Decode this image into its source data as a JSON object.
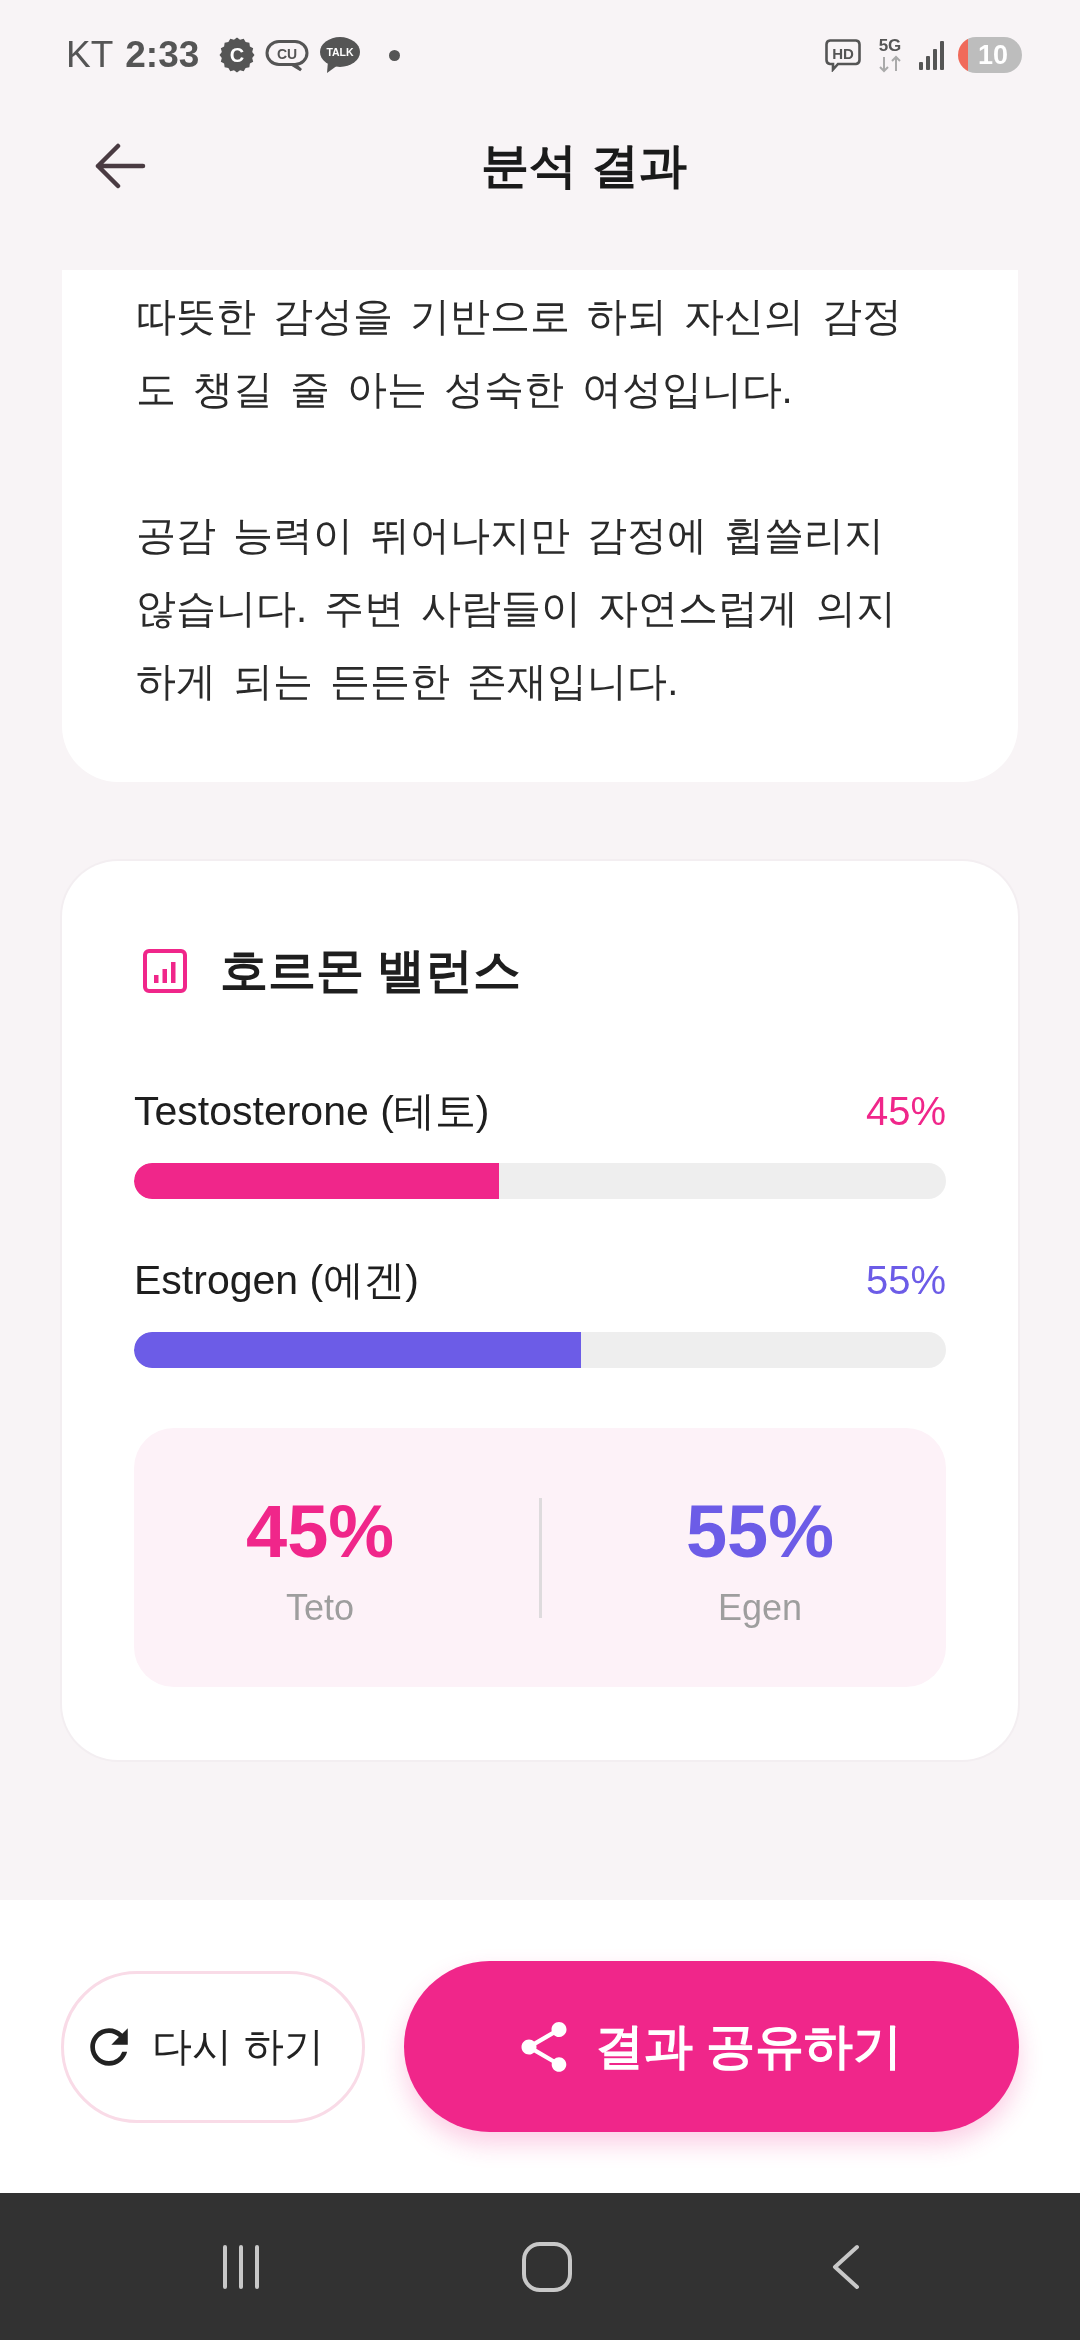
{
  "status_bar": {
    "carrier": "KT",
    "time": "2:33",
    "notifications": [
      {
        "kind": "badge",
        "label": "C"
      },
      {
        "kind": "outline_bubble",
        "label": "CU"
      },
      {
        "kind": "filled_bubble",
        "label": "TALK"
      },
      {
        "kind": "dot"
      }
    ],
    "indicators": [
      {
        "kind": "boxed",
        "label": "HD"
      },
      {
        "kind": "network",
        "label": "5G"
      },
      {
        "kind": "signal"
      }
    ],
    "battery": "10"
  },
  "header": {
    "title": "분석 결과"
  },
  "description": {
    "paragraphs": [
      "따뜻한 감성을 기반으로 하되 자신의 감정도 챙길 줄 아는 성숙한 여성입니다.",
      "공감 능력이 뛰어나지만 감정에 휩쓸리지 않습니다. 주변 사람들이 자연스럽게 의지하게 되는 든든한 존재입니다."
    ]
  },
  "hormone_balance": {
    "title": "호르몬 밸런스",
    "hormones": [
      {
        "label": "Testosterone (테토)",
        "value": "45%",
        "level": 0.45,
        "color": "#f0268a"
      },
      {
        "label": "Estrogen (에겐)",
        "value": "55%",
        "level": 0.55,
        "color": "#6c5ce7"
      }
    ],
    "summary": [
      {
        "value": "45%",
        "label": "Teto",
        "color": "#f0268a"
      },
      {
        "value": "55%",
        "label": "Egen",
        "color": "#6c5ce7"
      }
    ]
  },
  "actions": [
    {
      "kind": "secondary",
      "label": "다시 하기"
    },
    {
      "kind": "primary",
      "label": "결과 공유하기"
    }
  ]
}
